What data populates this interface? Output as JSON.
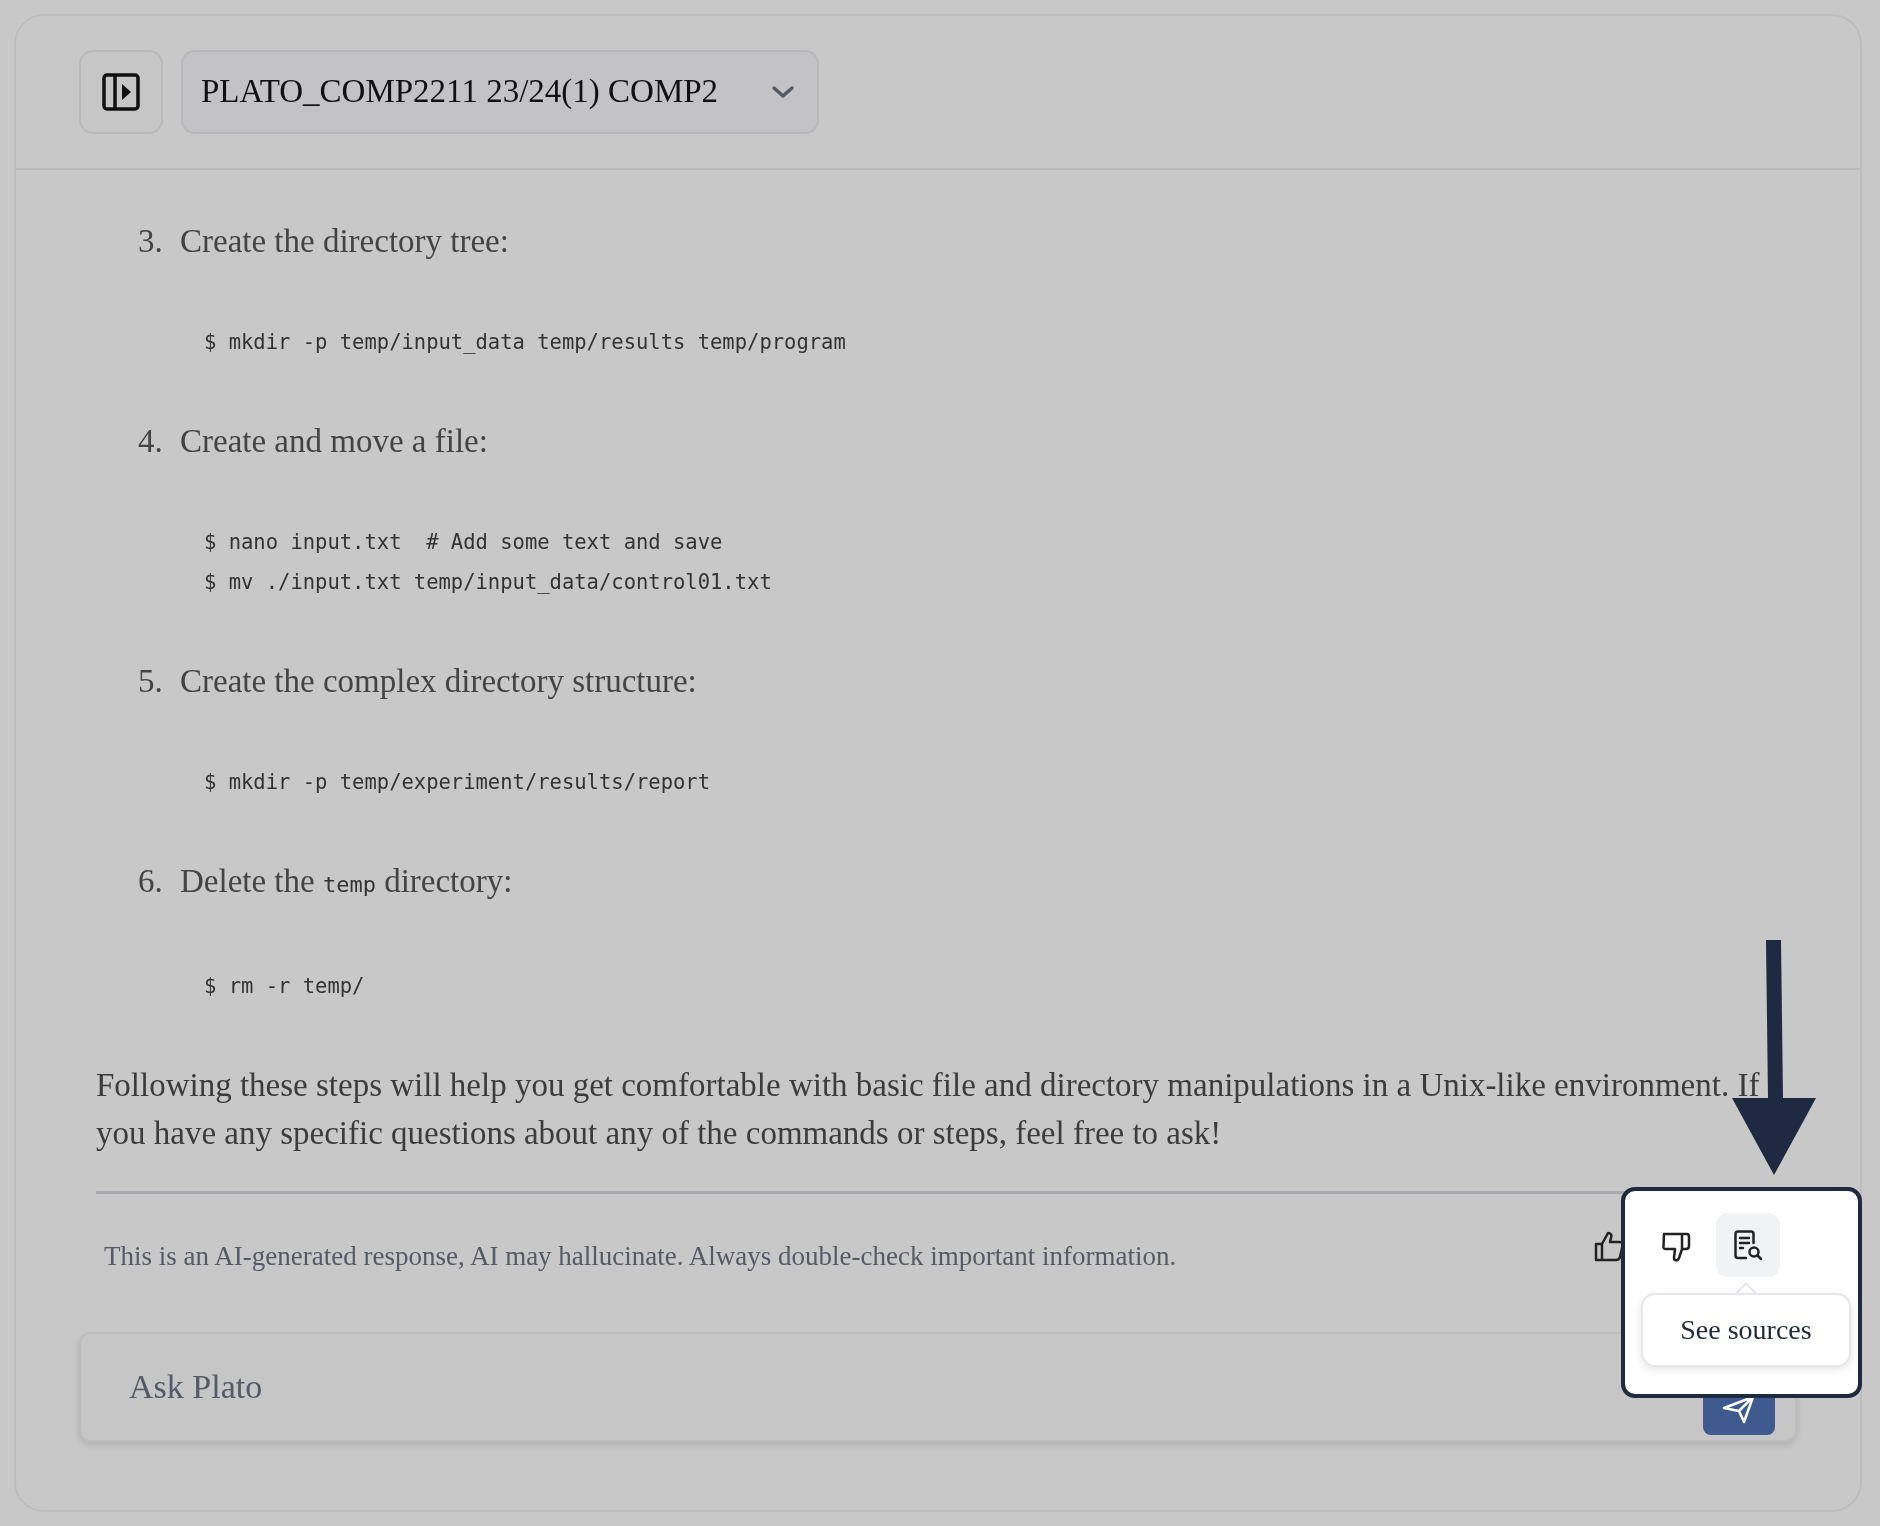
{
  "header": {
    "title": "PLATO_COMP2211 23/24(1) COMP2"
  },
  "steps": [
    {
      "number": "3.",
      "segments": [
        {
          "kind": "text",
          "text": "Create the directory tree:"
        }
      ],
      "code": [
        "$ mkdir -p temp/input_data temp/results temp/program"
      ]
    },
    {
      "number": "4.",
      "segments": [
        {
          "kind": "text",
          "text": "Create and move a file:"
        }
      ],
      "code": [
        "$ nano input.txt  # Add some text and save",
        "$ mv ./input.txt temp/input_data/control01.txt"
      ]
    },
    {
      "number": "5.",
      "segments": [
        {
          "kind": "text",
          "text": "Create the complex directory structure:"
        }
      ],
      "code": [
        "$ mkdir -p temp/experiment/results/report"
      ]
    },
    {
      "number": "6.",
      "segments": [
        {
          "kind": "text",
          "text": "Delete the "
        },
        {
          "kind": "code",
          "text": "temp"
        },
        {
          "kind": "text",
          "text": " directory:"
        }
      ],
      "code": [
        "$ rm -r temp/"
      ]
    }
  ],
  "conclusion": "Following these steps will help you get comfortable with basic file and directory manipulations in a Unix-like environment. If you have any specific questions about any of the commands or steps, feel free to ask!",
  "disclaimer": "This is an AI-generated response, AI may hallucinate. Always double-check important information.",
  "input": {
    "placeholder": "Ask Plato"
  },
  "tooltip": "See sources"
}
